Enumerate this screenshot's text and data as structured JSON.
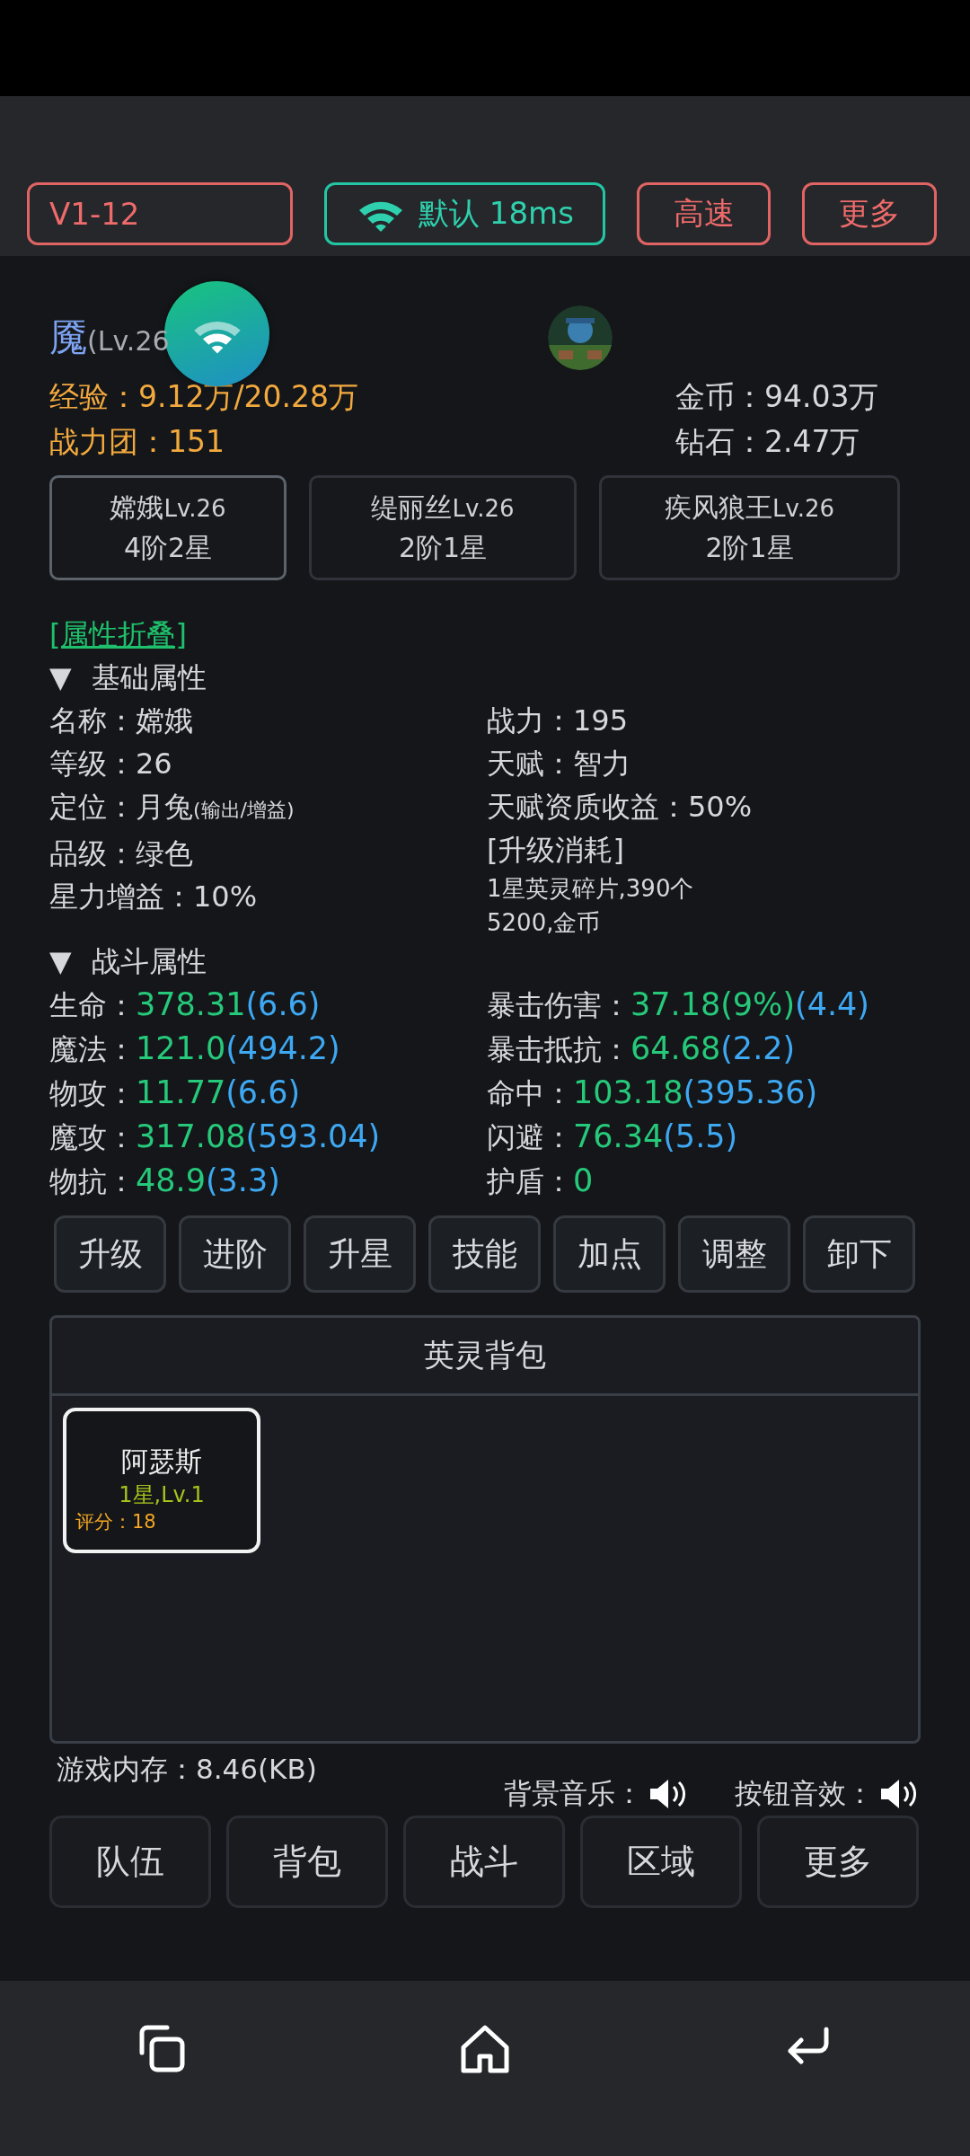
{
  "toolbar": {
    "version": "V1-12",
    "network": "默认 18ms",
    "speed": "高速",
    "more": "更多"
  },
  "player": {
    "name": "魇",
    "level": "(Lv.26",
    "exp": "经验：9.12万/20.28万",
    "team_power": "战力团：151",
    "gold": "金币：94.03万",
    "diamond": "钻石：2.47万"
  },
  "heroes": [
    {
      "name": "嫦娥",
      "level": "Lv.26",
      "rank": "4阶2星",
      "selected": true
    },
    {
      "name": "缇丽丝",
      "level": "Lv.26",
      "rank": "2阶1星",
      "selected": false
    },
    {
      "name": "疾风狼王",
      "level": "Lv.26",
      "rank": "2阶1星",
      "selected": false
    }
  ],
  "collapse_link": "[属性折叠]",
  "basic": {
    "toggle": "▼",
    "title": "基础属性",
    "left": [
      {
        "label": "名称：",
        "value": "嫦娥"
      },
      {
        "label": "等级：",
        "value": "26"
      },
      {
        "label": "定位：",
        "value": "月兔",
        "note": "(输出/增益)"
      },
      {
        "label": "品级：",
        "value": "绿色"
      },
      {
        "label": "星力增益：",
        "value": "10%"
      }
    ],
    "right": [
      {
        "kind": "pair",
        "label": "战力：",
        "value": "195"
      },
      {
        "kind": "pair",
        "label": "天赋：",
        "value": "智力"
      },
      {
        "kind": "pair",
        "label": "天赋资质收益：",
        "value": "50%"
      },
      {
        "kind": "heading",
        "label": "[升级消耗]"
      },
      {
        "kind": "cost",
        "label": "1星英灵碎片,390个"
      },
      {
        "kind": "cost",
        "label": "5200,金币"
      }
    ]
  },
  "combat": {
    "toggle": "▼",
    "title": "战斗属性",
    "left": [
      {
        "label": "生命：",
        "value": "378.31",
        "bonus": "(6.6)"
      },
      {
        "label": "魔法：",
        "value": "121.0",
        "bonus": "(494.2)"
      },
      {
        "label": "物攻：",
        "value": "11.77",
        "bonus": "(6.6)"
      },
      {
        "label": "魔攻：",
        "value": "317.08",
        "bonus": "(593.04)"
      },
      {
        "label": "物抗：",
        "value": "48.9",
        "bonus": "(3.3)"
      }
    ],
    "right": [
      {
        "label": "暴击伤害：",
        "value": "37.18(9%)",
        "bonus": "(4.4)"
      },
      {
        "label": "暴击抵抗：",
        "value": "64.68",
        "bonus": "(2.2)"
      },
      {
        "label": "命中：",
        "value": "103.18",
        "bonus": "(395.36)"
      },
      {
        "label": "闪避：",
        "value": "76.34",
        "bonus": "(5.5)"
      },
      {
        "label": "护盾：",
        "value": "0"
      }
    ]
  },
  "actions": [
    "升级",
    "进阶",
    "升星",
    "技能",
    "加点",
    "调整",
    "卸下"
  ],
  "bag": {
    "title": "英灵背包",
    "items": [
      {
        "name": "阿瑟斯",
        "info": "1星,Lv.1",
        "score": "评分：18"
      }
    ]
  },
  "memory": "游戏内存：8.46(KB)",
  "sounds": [
    {
      "label": "背景音乐：",
      "on": true
    },
    {
      "label": "按钮音效：",
      "on": true
    }
  ],
  "nav": [
    "队伍",
    "背包",
    "战斗",
    "区域",
    "更多"
  ]
}
